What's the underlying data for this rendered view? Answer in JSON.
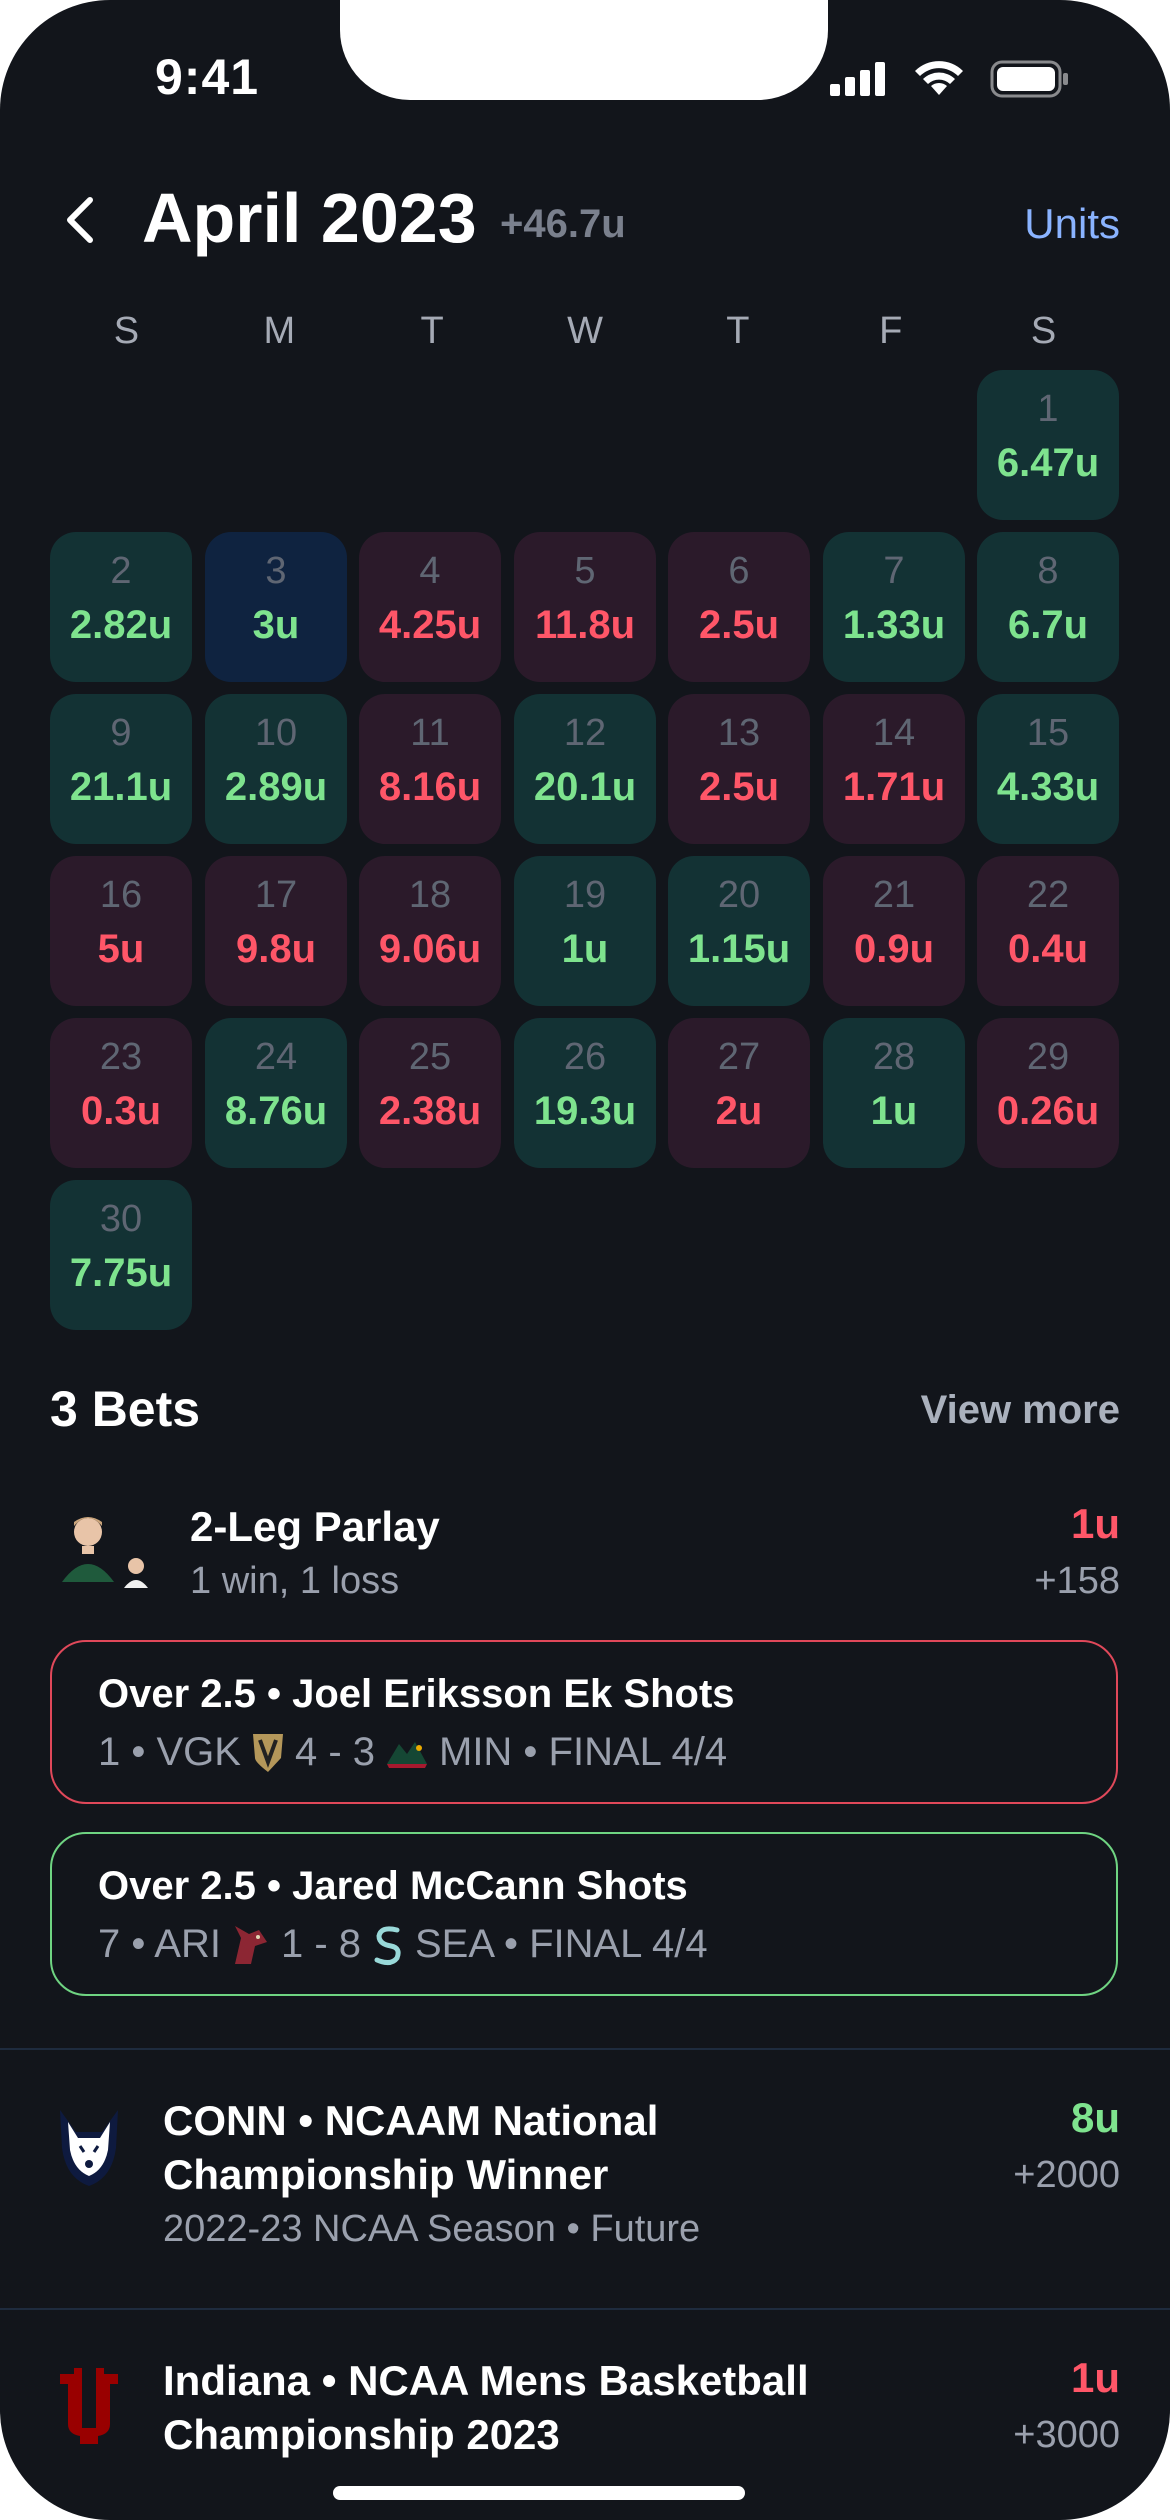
{
  "status_bar": {
    "time": "9:41"
  },
  "header": {
    "title": "April 2023",
    "total": "+46.7u",
    "units_label": "Units"
  },
  "weekdays": [
    "S",
    "M",
    "T",
    "W",
    "T",
    "F",
    "S"
  ],
  "calendar": [
    {
      "day": "1",
      "units": "6.47u",
      "result": "win"
    },
    {
      "day": "2",
      "units": "2.82u",
      "result": "win"
    },
    {
      "day": "3",
      "units": "3u",
      "result": "push"
    },
    {
      "day": "4",
      "units": "4.25u",
      "result": "loss"
    },
    {
      "day": "5",
      "units": "11.8u",
      "result": "loss"
    },
    {
      "day": "6",
      "units": "2.5u",
      "result": "loss"
    },
    {
      "day": "7",
      "units": "1.33u",
      "result": "win"
    },
    {
      "day": "8",
      "units": "6.7u",
      "result": "win"
    },
    {
      "day": "9",
      "units": "21.1u",
      "result": "win"
    },
    {
      "day": "10",
      "units": "2.89u",
      "result": "win"
    },
    {
      "day": "11",
      "units": "8.16u",
      "result": "loss"
    },
    {
      "day": "12",
      "units": "20.1u",
      "result": "win"
    },
    {
      "day": "13",
      "units": "2.5u",
      "result": "loss"
    },
    {
      "day": "14",
      "units": "1.71u",
      "result": "loss"
    },
    {
      "day": "15",
      "units": "4.33u",
      "result": "win"
    },
    {
      "day": "16",
      "units": "5u",
      "result": "loss"
    },
    {
      "day": "17",
      "units": "9.8u",
      "result": "loss"
    },
    {
      "day": "18",
      "units": "9.06u",
      "result": "loss"
    },
    {
      "day": "19",
      "units": "1u",
      "result": "win"
    },
    {
      "day": "20",
      "units": "1.15u",
      "result": "win"
    },
    {
      "day": "21",
      "units": "0.9u",
      "result": "loss"
    },
    {
      "day": "22",
      "units": "0.4u",
      "result": "loss"
    },
    {
      "day": "23",
      "units": "0.3u",
      "result": "loss"
    },
    {
      "day": "24",
      "units": "8.76u",
      "result": "win"
    },
    {
      "day": "25",
      "units": "2.38u",
      "result": "loss"
    },
    {
      "day": "26",
      "units": "19.3u",
      "result": "win"
    },
    {
      "day": "27",
      "units": "2u",
      "result": "loss"
    },
    {
      "day": "28",
      "units": "1u",
      "result": "win"
    },
    {
      "day": "29",
      "units": "0.26u",
      "result": "loss"
    },
    {
      "day": "30",
      "units": "7.75u",
      "result": "win"
    }
  ],
  "bets_section": {
    "title": "3 Bets",
    "view_more": "View more"
  },
  "bets": [
    {
      "title": "2-Leg Parlay",
      "subtitle": "1 win, 1 loss",
      "units": "1u",
      "odds": "+158",
      "units_color": "#ff5668",
      "legs": [
        {
          "title": "Over 2.5 • Joel Eriksson Ek Shots",
          "prefix": "1 • VGK",
          "score": "4 - 3",
          "suffix": "MIN • FINAL 4/4",
          "status": "lost"
        },
        {
          "title": "Over 2.5 • Jared McCann Shots",
          "prefix": "7 • ARI",
          "score": "1 - 8",
          "suffix": "SEA • FINAL 4/4",
          "status": "won"
        }
      ]
    },
    {
      "title_line1": "CONN • NCAAM National",
      "title_line2": "Championship Winner",
      "subtitle": "2022-23 NCAA Season • Future",
      "units": "8u",
      "odds": "+2000",
      "units_color": "#7ee38e"
    },
    {
      "title_line1": "Indiana • NCAA Mens Basketball",
      "title_line2": "Championship 2023",
      "units": "1u",
      "odds": "+3000",
      "units_color": "#ff5668"
    }
  ],
  "colors": {
    "background": "#12151b",
    "win": "#7ee38e",
    "loss": "#ff5668",
    "accent": "#8ab3ff"
  },
  "icons": [
    "back-chevron-icon",
    "signal-icon",
    "wifi-icon",
    "battery-icon",
    "vgk-logo-icon",
    "wild-logo-icon",
    "coyotes-logo-icon",
    "kraken-logo-icon",
    "uconn-husky-icon",
    "indiana-logo-icon"
  ]
}
